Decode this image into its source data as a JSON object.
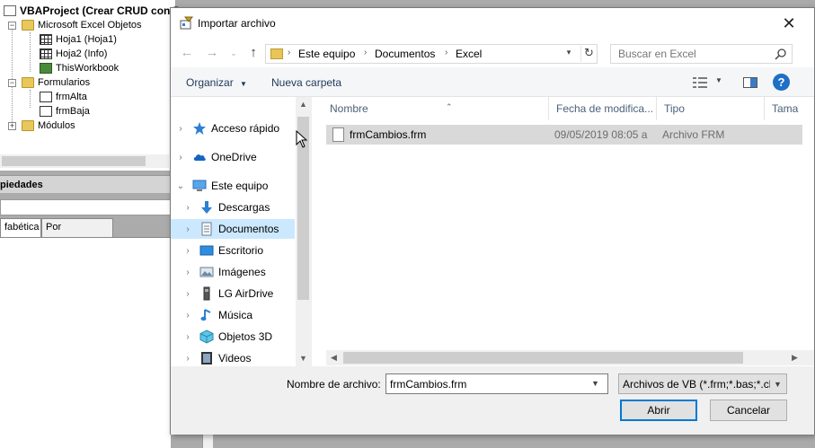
{
  "background": {
    "project_title": "VBAProject (Crear CRUD con D",
    "tree": [
      {
        "label": "Microsoft Excel Objetos",
        "icon": "folder-icon"
      },
      {
        "label": "Hoja1 (Hoja1)",
        "icon": "sheet-icon"
      },
      {
        "label": "Hoja2 (Info)",
        "icon": "sheet-icon"
      },
      {
        "label": "ThisWorkbook",
        "icon": "workbook-icon"
      },
      {
        "label": "Formularios",
        "icon": "folder-icon"
      },
      {
        "label": "frmAlta",
        "icon": "form-icon"
      },
      {
        "label": "frmBaja",
        "icon": "form-icon"
      },
      {
        "label": "Módulos",
        "icon": "folder-icon"
      }
    ],
    "properties_title": "piedades",
    "props_tabs": [
      "fabética",
      "Por categorías"
    ]
  },
  "dialog": {
    "title": "Importar archivo",
    "close_label": "✕",
    "address": {
      "crumbs": [
        "Este equipo",
        "Documentos",
        "Excel"
      ]
    },
    "search": {
      "placeholder": "Buscar en Excel"
    },
    "toolbar": {
      "organize_label": "Organizar",
      "new_folder_label": "Nueva carpeta",
      "help_label": "?"
    },
    "nav_items": [
      {
        "label": "Acceso rápido",
        "icon": "star-icon"
      },
      {
        "label": "OneDrive",
        "icon": "cloud-icon"
      },
      {
        "label": "Este equipo",
        "icon": "computer-icon"
      },
      {
        "label": "Descargas",
        "icon": "download-icon"
      },
      {
        "label": "Documentos",
        "icon": "document-icon"
      },
      {
        "label": "Escritorio",
        "icon": "desktop-icon"
      },
      {
        "label": "Imágenes",
        "icon": "image-icon"
      },
      {
        "label": "LG AirDrive",
        "icon": "drive-icon"
      },
      {
        "label": "Música",
        "icon": "music-icon"
      },
      {
        "label": "Objetos 3D",
        "icon": "cube-icon"
      },
      {
        "label": "Videos",
        "icon": "video-icon"
      }
    ],
    "columns": [
      "Nombre",
      "Fecha de modifica...",
      "Tipo",
      "Tama"
    ],
    "files": [
      {
        "name": "frmCambios.frm",
        "date": "09/05/2019 08:05 a",
        "type": "Archivo FRM"
      }
    ],
    "filename_label": "Nombre de archivo:",
    "filename_value": "frmCambios.frm",
    "filetype_value": "Archivos de VB (*.frm;*.bas;*.cl:",
    "open_label": "Abrir",
    "cancel_label": "Cancelar"
  },
  "colors": {
    "selection": "#cce8ff",
    "accent": "#0078d7",
    "link_text": "#1e395b"
  }
}
